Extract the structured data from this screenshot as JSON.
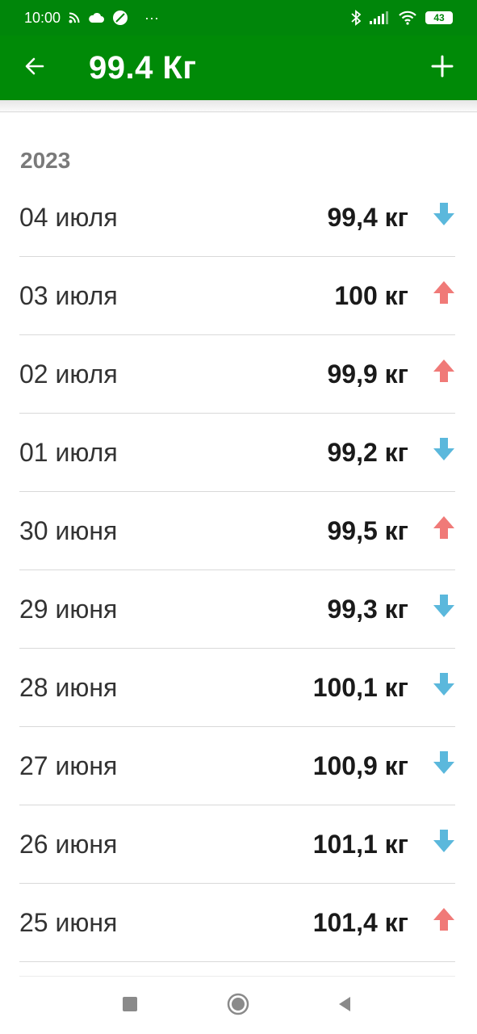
{
  "status_bar": {
    "time": "10:00",
    "more": "···",
    "battery": "43",
    "icons": [
      "rss-icon",
      "cloud-icon",
      "no-sim-icon",
      "bluetooth-icon",
      "signal-icon",
      "wifi-icon",
      "battery-icon"
    ]
  },
  "app_bar": {
    "title": "99.4 Кг",
    "back_icon": "arrow-left-icon",
    "add_icon": "plus-icon",
    "color": "#008a07"
  },
  "section": {
    "year": "2023"
  },
  "entries": [
    {
      "date": "04 июля",
      "weight": "99,4 кг",
      "trend": "down"
    },
    {
      "date": "03 июля",
      "weight": "100 кг",
      "trend": "up"
    },
    {
      "date": "02 июля",
      "weight": "99,9 кг",
      "trend": "up"
    },
    {
      "date": "01 июля",
      "weight": "99,2 кг",
      "trend": "down"
    },
    {
      "date": "30 июня",
      "weight": "99,5 кг",
      "trend": "up"
    },
    {
      "date": "29 июня",
      "weight": "99,3 кг",
      "trend": "down"
    },
    {
      "date": "28 июня",
      "weight": "100,1 кг",
      "trend": "down"
    },
    {
      "date": "27 июня",
      "weight": "100,9 кг",
      "trend": "down"
    },
    {
      "date": "26 июня",
      "weight": "101,1 кг",
      "trend": "down"
    },
    {
      "date": "25 июня",
      "weight": "101,4 кг",
      "trend": "up"
    }
  ],
  "trend_colors": {
    "down": "#5bb8dc",
    "up": "#f07a78"
  },
  "nav_bar": {
    "icons": [
      "recents-icon",
      "home-icon",
      "back-triangle-icon"
    ]
  }
}
